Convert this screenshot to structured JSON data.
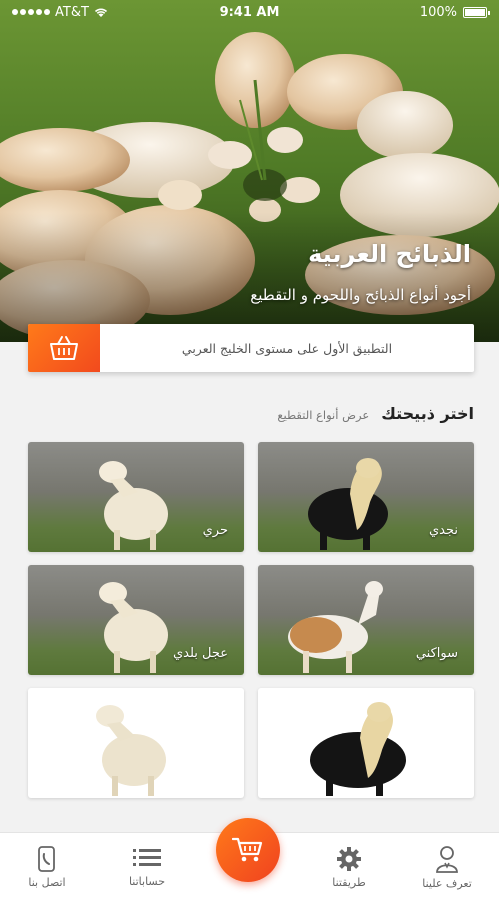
{
  "status_bar": {
    "carrier": "AT&T",
    "time": "9:41 AM",
    "battery": "100%",
    "battery_level": 1.0
  },
  "hero": {
    "title": "الذبائح العربية",
    "subtitle": "أجود أنواع الذبائح واللحوم و التقطيع"
  },
  "banner": {
    "icon": "basket-icon",
    "text": "التطبيق الأول على مستوى الخليج العربي"
  },
  "section": {
    "title": "اختر ذبيحتك",
    "link": "عرض أنواع التقطيع"
  },
  "cards": [
    {
      "label": "نجدي",
      "animal": "black-sheep"
    },
    {
      "label": "حري",
      "animal": "white-sheep"
    },
    {
      "label": "سواكني",
      "animal": "brown-white-goat"
    },
    {
      "label": "عجل بلدي",
      "animal": "white-sheep"
    },
    {
      "label": "",
      "animal": "black-sheep"
    },
    {
      "label": "",
      "animal": "white-sheep"
    }
  ],
  "nav": {
    "about": "تعرف علينا",
    "method": "طريقتنا",
    "cart": "cart-icon",
    "accounts": "حساباتنا",
    "contact": "اتصل بنا"
  },
  "colors": {
    "accent": "#f24a1d",
    "accent_light": "#ff7a1a"
  }
}
